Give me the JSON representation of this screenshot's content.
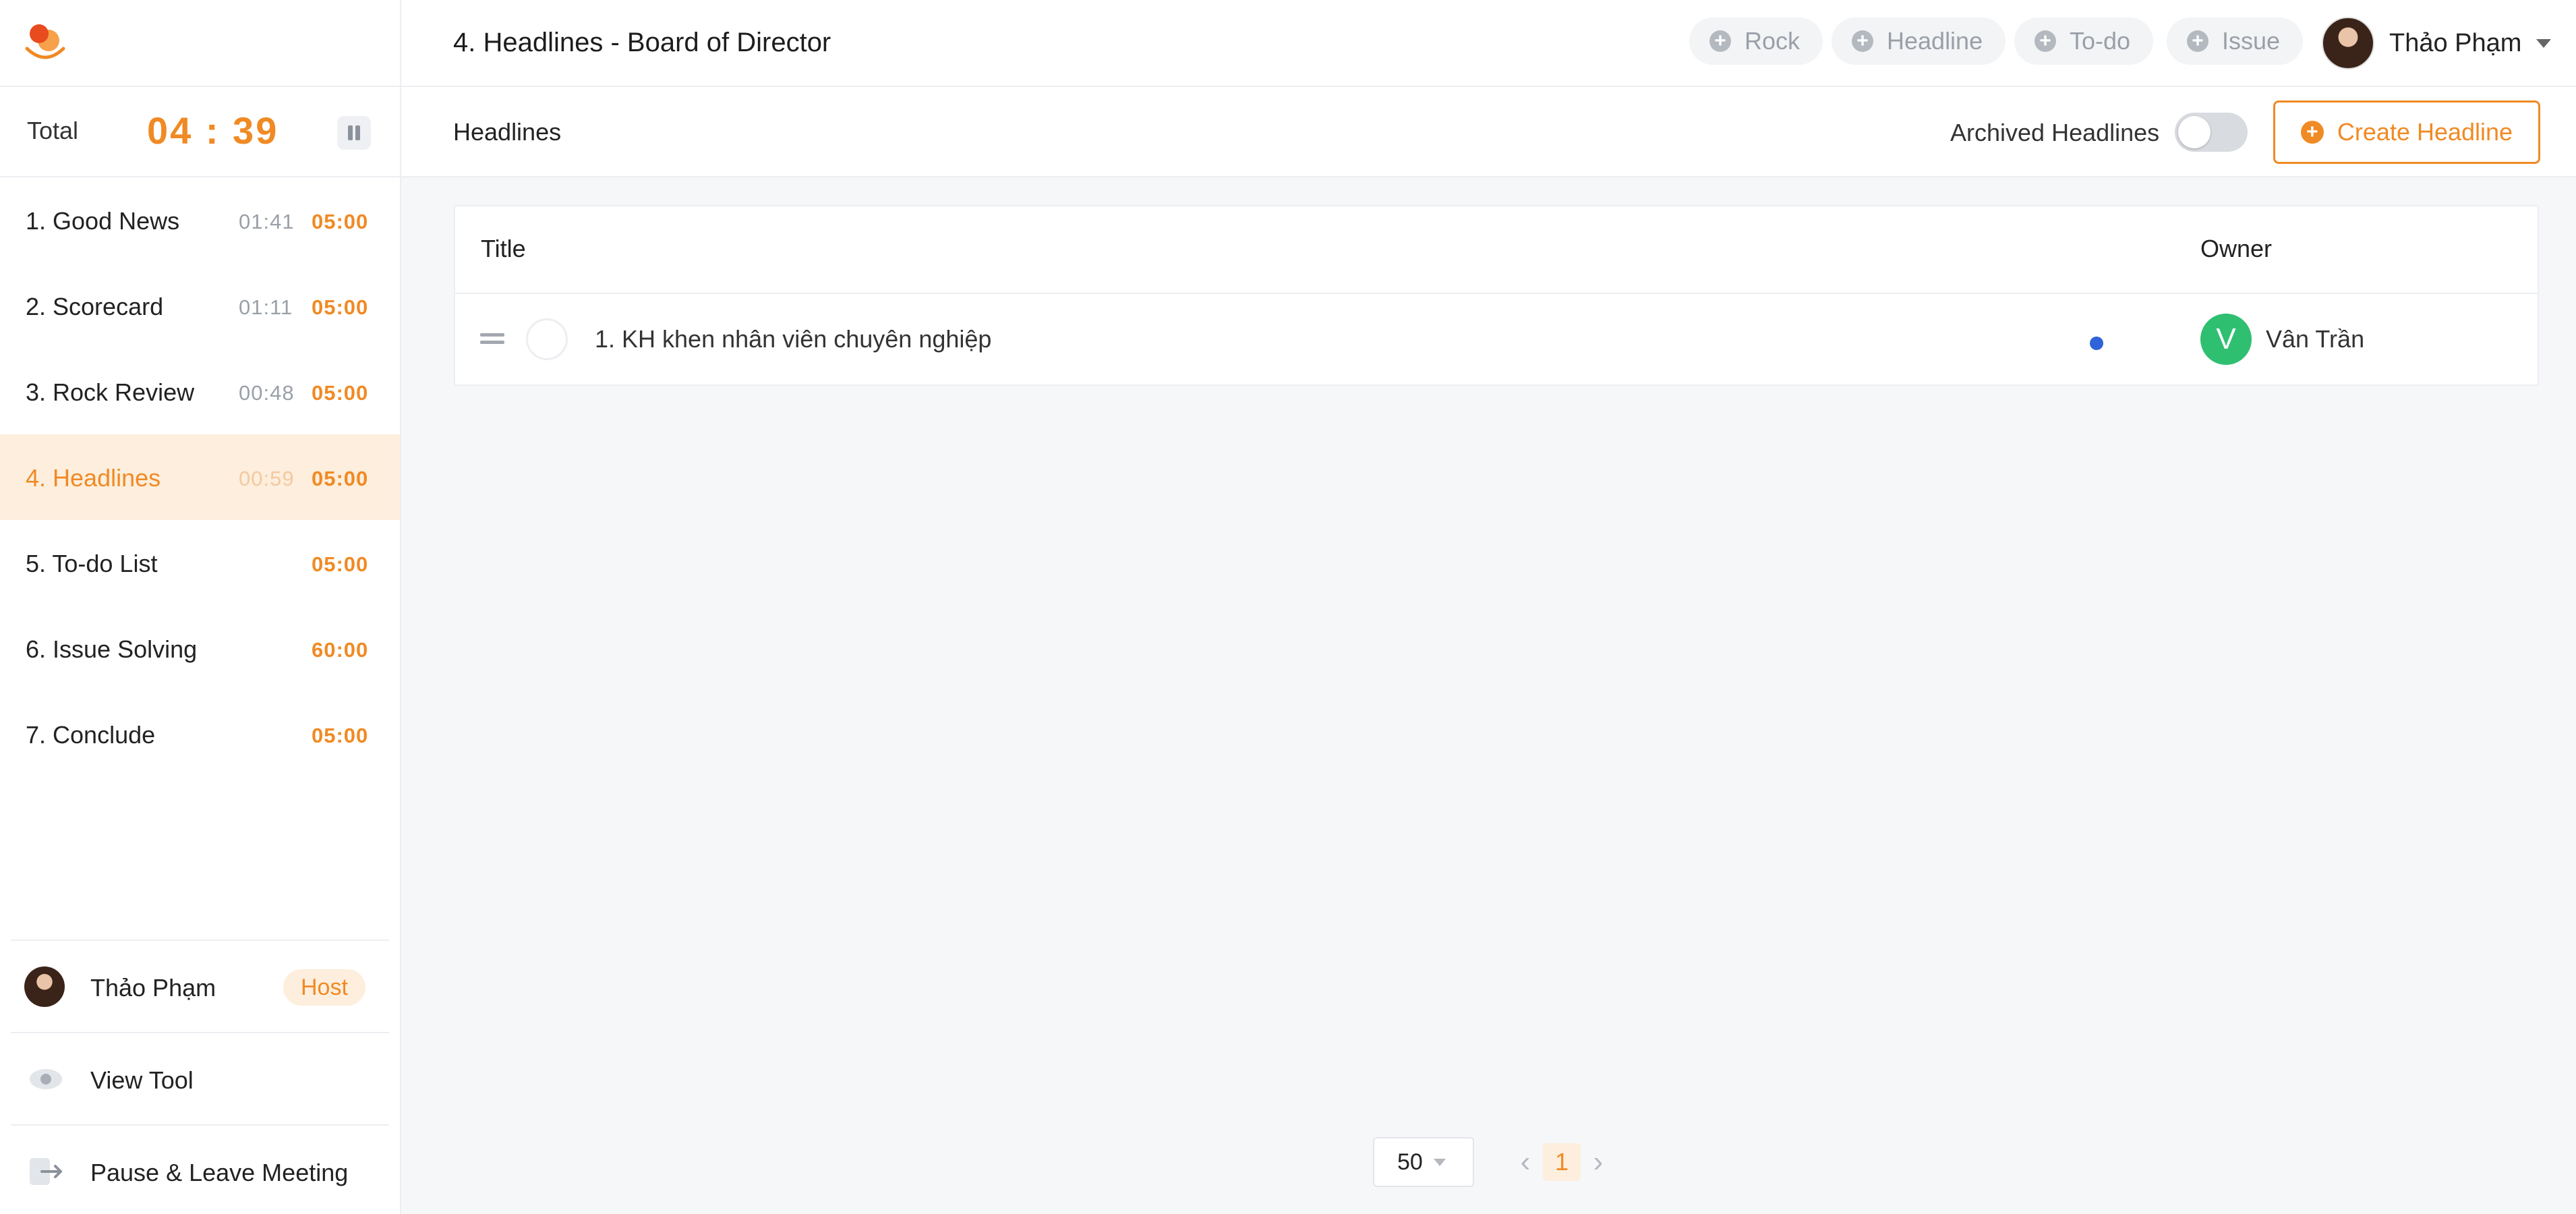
{
  "header": {
    "title": "4. Headlines - Board of Director",
    "quick_add": [
      {
        "label": "Rock"
      },
      {
        "label": "Headline"
      },
      {
        "label": "To-do"
      },
      {
        "label": "Issue"
      }
    ],
    "user_name": "Thảo Phạm"
  },
  "sidebar": {
    "total_label": "Total",
    "total_time": "04 : 39",
    "agenda": [
      {
        "label": "1.  Good News",
        "spent": "01:41",
        "limit": "05:00"
      },
      {
        "label": "2.  Scorecard",
        "spent": "01:11",
        "limit": "05:00"
      },
      {
        "label": "3.  Rock Review",
        "spent": "00:48",
        "limit": "05:00"
      },
      {
        "label": "4.  Headlines",
        "spent": "00:59",
        "limit": "05:00"
      },
      {
        "label": "5.  To-do List",
        "spent": "",
        "limit": "05:00"
      },
      {
        "label": "6.  Issue Solving",
        "spent": "",
        "limit": "60:00"
      },
      {
        "label": "7.  Conclude",
        "spent": "",
        "limit": "05:00"
      }
    ],
    "host_name": "Thảo Phạm",
    "host_badge": "Host",
    "view_tool": "View Tool",
    "leave": "Pause & Leave Meeting"
  },
  "main": {
    "section_title": "Headlines",
    "archived_label": "Archived Headlines",
    "create_label": "Create Headline",
    "columns": {
      "title": "Title",
      "owner": "Owner"
    },
    "rows": [
      {
        "title": "1. KH khen nhân viên chuyên nghiệp",
        "owner_initial": "V",
        "owner_name": "Vân Trần"
      }
    ],
    "pagination": {
      "page_size": "50",
      "current_page": "1"
    }
  },
  "colors": {
    "accent": "#f08a24",
    "active_bg": "#fdeedd",
    "status_dot": "#2f63d9",
    "owner_avatar": "#2fbf71"
  }
}
